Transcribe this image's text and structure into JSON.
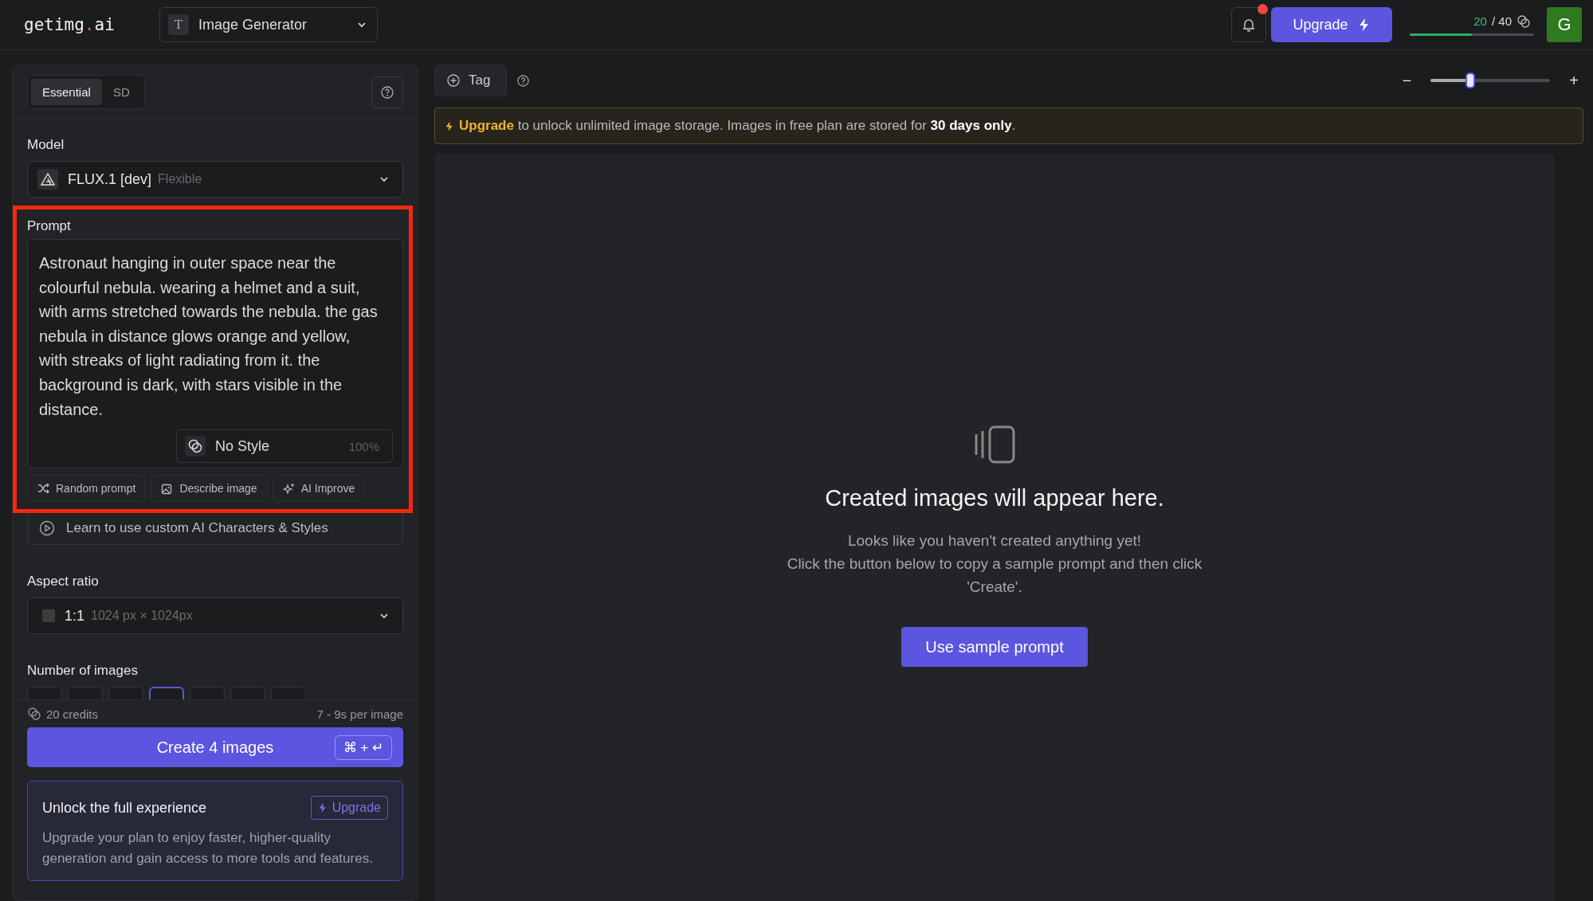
{
  "header": {
    "logo": {
      "main": "getimg",
      "dot": ".",
      "tld": "ai"
    },
    "tool_select": {
      "icon_letter": "T",
      "value": "Image Generator"
    },
    "notification": {
      "unread": true
    },
    "upgrade_button": "Upgrade",
    "credits": {
      "used": "20",
      "total": "/ 40",
      "level": 0.5
    },
    "avatar": "G"
  },
  "sidebar": {
    "tabs": [
      {
        "label": "Essential",
        "selected": true
      },
      {
        "label": "SD",
        "selected": false
      }
    ],
    "model": {
      "label": "Model",
      "value": "FLUX.1 [dev]",
      "hint": "Flexible"
    },
    "prompt": {
      "label": "Prompt",
      "value": "Astronaut hanging in outer space near the colourful nebula. wearing a helmet and a suit, with arms stretched towards the nebula. the gas nebula in distance glows orange and yellow, with streaks of light radiating from it. the background is dark, with stars visible in the distance.",
      "style": "No Style",
      "style_strength": "100%"
    },
    "prompt_actions": [
      {
        "kind": "random",
        "label": "Random prompt"
      },
      {
        "kind": "describe",
        "label": "Describe image"
      },
      {
        "kind": "improve",
        "label": "AI Improve"
      }
    ],
    "learn_link": "Learn to use custom AI Characters & Styles",
    "aspect_ratio": {
      "label": "Aspect ratio",
      "value": "1:1",
      "hint": "1024 px × 1024px"
    },
    "number_of_images": {
      "label": "Number of images",
      "options": [
        {
          "selected": false
        },
        {
          "selected": false
        },
        {
          "selected": false
        },
        {
          "selected": true
        },
        {
          "selected": false
        },
        {
          "selected": false
        },
        {
          "selected": false
        }
      ]
    },
    "cost": {
      "credits": "20 credits",
      "time": "7 - 9s per image"
    },
    "create_button": {
      "label": "Create 4 images",
      "shortcut": "⌘ + ↵"
    },
    "promo": {
      "title": "Unlock the full experience",
      "button": "Upgrade",
      "text": "Upgrade your plan to enjoy faster, higher-quality generation and gain access to more tools and features."
    }
  },
  "toolbar": {
    "tag_button": "Tag",
    "zoom": {
      "minus": "−",
      "plus": "+",
      "level": 0.33
    }
  },
  "banner": {
    "text": "**Upgrade** to unlock unlimited image storage. Images in free plan are stored for **30 days only**."
  },
  "empty_state": {
    "title": "Created images will appear here.",
    "lines": [
      "Looks like you haven't created anything yet!",
      "Click the button below to copy a sample prompt and then click 'Create'."
    ],
    "button": "Use sample prompt"
  }
}
